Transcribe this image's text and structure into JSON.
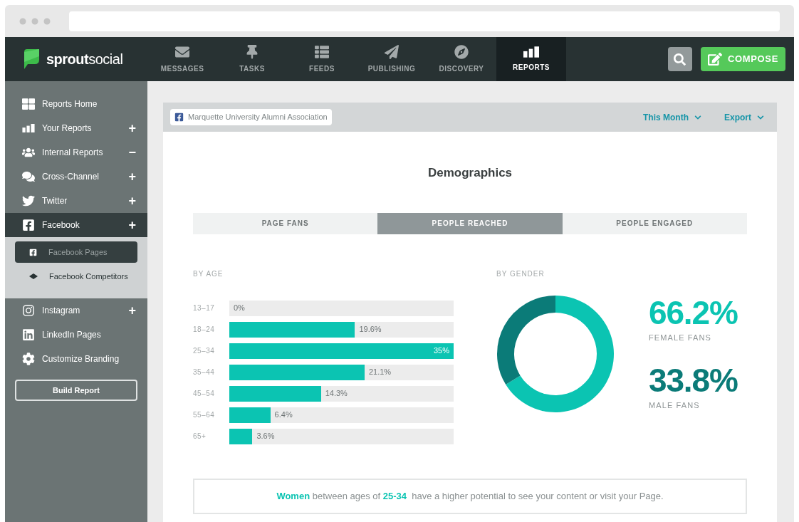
{
  "brand": {
    "name_bold": "sprout",
    "name_light": "social"
  },
  "nav": [
    {
      "label": "MESSAGES",
      "selected": false
    },
    {
      "label": "TASKS",
      "selected": false
    },
    {
      "label": "FEEDS",
      "selected": false
    },
    {
      "label": "PUBLISHING",
      "selected": false
    },
    {
      "label": "DISCOVERY",
      "selected": false
    },
    {
      "label": "REPORTS",
      "selected": true
    }
  ],
  "compose": {
    "label": "COMPOSE"
  },
  "sidebar": {
    "items": [
      {
        "label": "Reports Home",
        "selected": false
      },
      {
        "label": "Your Reports",
        "toggle": "+",
        "selected": false
      },
      {
        "label": "Internal Reports",
        "toggle": "−",
        "selected": false
      },
      {
        "label": "Cross-Channel",
        "toggle": "+",
        "selected": false
      },
      {
        "label": "Twitter",
        "toggle": "+",
        "selected": false
      },
      {
        "label": "Facebook",
        "toggle": "+",
        "selected": true,
        "children": [
          {
            "label": "Facebook Pages",
            "selected": true
          },
          {
            "label": "Facebook Competitors",
            "selected": false
          }
        ]
      },
      {
        "label": "Instagram",
        "toggle": "+",
        "selected": false
      },
      {
        "label": "LinkedIn Pages",
        "selected": false
      },
      {
        "label": "Customize Branding",
        "selected": false
      }
    ],
    "button": "Build Report"
  },
  "report": {
    "profile": "Marquette University Alumni Association",
    "period": "This Month",
    "export": "Export",
    "title": "Demographics",
    "tabs": [
      {
        "label": "PAGE FANS",
        "selected": false
      },
      {
        "label": "PEOPLE REACHED",
        "selected": true
      },
      {
        "label": "PEOPLE ENGAGED",
        "selected": false
      }
    ],
    "by_age": {
      "heading": "BY AGE",
      "chart_data": {
        "type": "bar",
        "orientation": "horizontal",
        "categories": [
          "13–17",
          "18–24",
          "25–34",
          "35–44",
          "45–54",
          "55–64",
          "65+"
        ],
        "values": [
          0,
          19.6,
          35,
          21.1,
          14.3,
          6.4,
          3.6
        ],
        "value_labels": [
          "0%",
          "19.6%",
          "35%",
          "21.1%",
          "14.3%",
          "6.4%",
          "3.6%"
        ],
        "xlim": [
          0,
          35
        ]
      }
    },
    "by_gender": {
      "heading": "BY GENDER",
      "chart_data": {
        "type": "donut",
        "values": [
          66.2,
          33.8
        ]
      },
      "legend": [
        {
          "value": "66.2%",
          "label": "FEMALE FANS"
        },
        {
          "value": "33.8%",
          "label": "MALE FANS"
        }
      ]
    },
    "insight": "**Women** between ages of **25-34**  have a higher potential to see your content or visit your Page."
  }
}
